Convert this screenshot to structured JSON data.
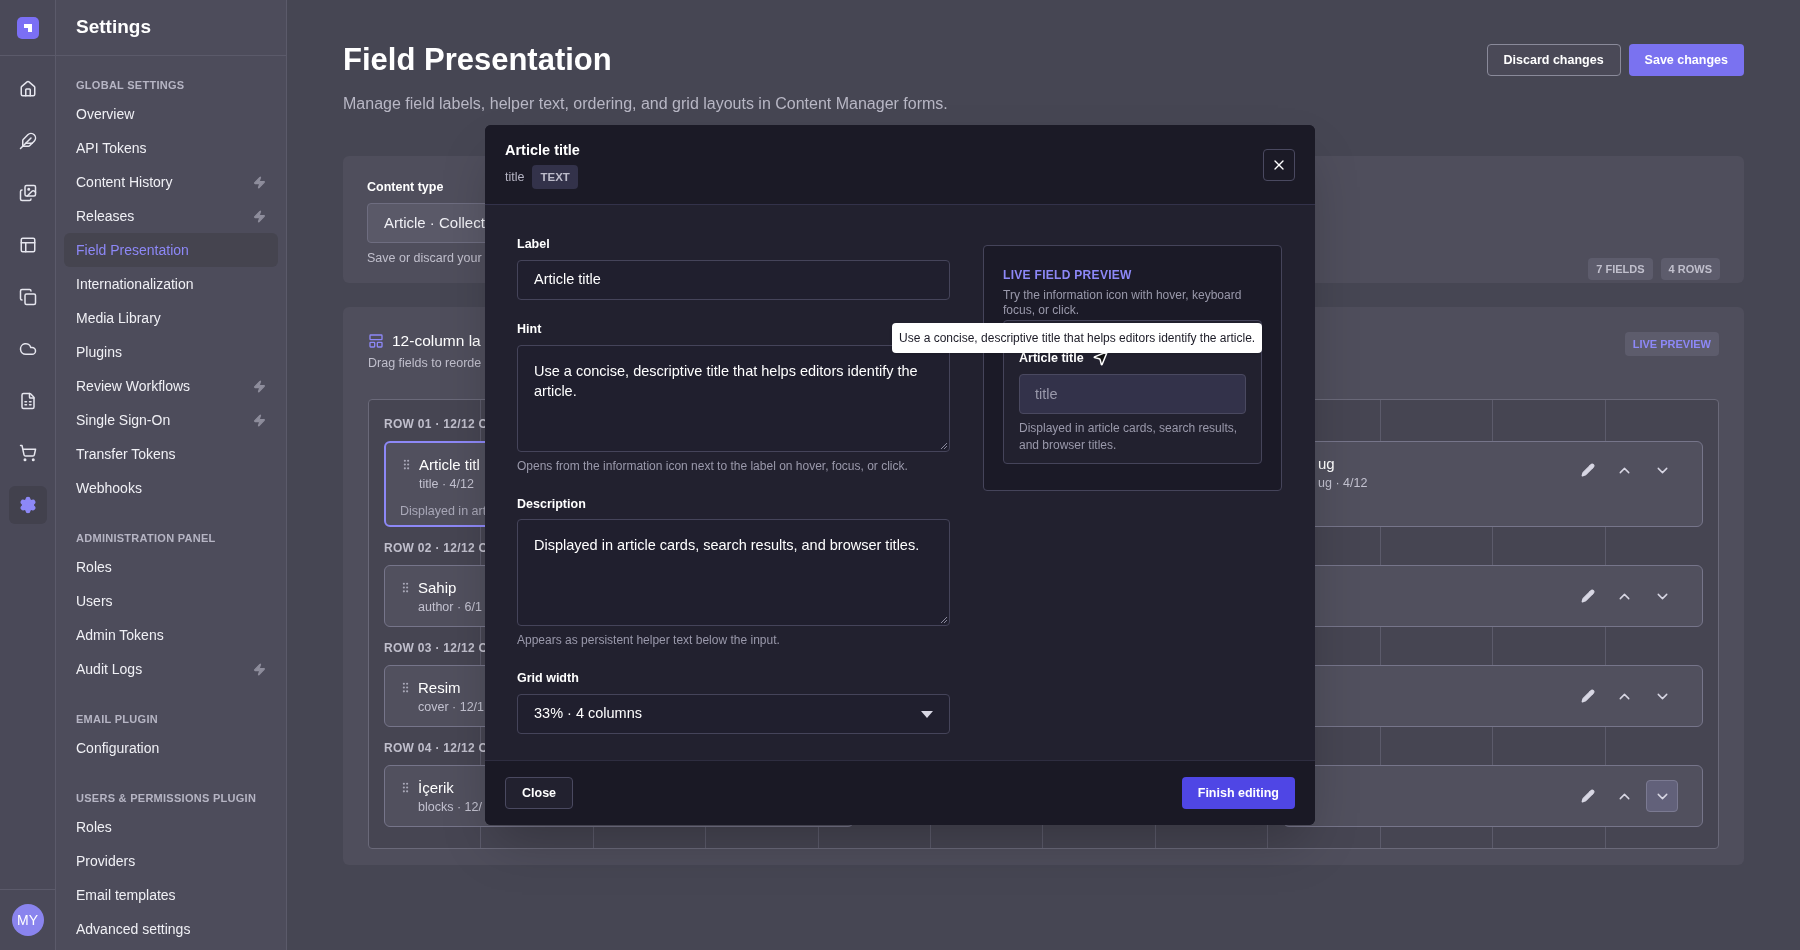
{
  "rail": {
    "items": [
      {
        "kind": "home",
        "selected": false
      },
      {
        "kind": "feather",
        "selected": false
      },
      {
        "kind": "images",
        "selected": false
      },
      {
        "kind": "layout",
        "selected": false
      },
      {
        "kind": "copy",
        "selected": false
      },
      {
        "kind": "cloud",
        "selected": false
      },
      {
        "kind": "spreadsheet",
        "selected": false
      },
      {
        "kind": "cart",
        "selected": false
      },
      {
        "kind": "settings",
        "selected": true
      }
    ],
    "avatar": "MY"
  },
  "sidebar": {
    "title": "Settings",
    "sections": [
      {
        "heading": "GLOBAL SETTINGS",
        "items": [
          {
            "label": "Overview",
            "selected": false,
            "bolt": false
          },
          {
            "label": "API Tokens",
            "selected": false,
            "bolt": false
          },
          {
            "label": "Content History",
            "selected": false,
            "bolt": true
          },
          {
            "label": "Releases",
            "selected": false,
            "bolt": true
          },
          {
            "label": "Field Presentation",
            "selected": true,
            "bolt": false
          },
          {
            "label": "Internationalization",
            "selected": false,
            "bolt": false
          },
          {
            "label": "Media Library",
            "selected": false,
            "bolt": false
          },
          {
            "label": "Plugins",
            "selected": false,
            "bolt": false
          },
          {
            "label": "Review Workflows",
            "selected": false,
            "bolt": true
          },
          {
            "label": "Single Sign-On",
            "selected": false,
            "bolt": true
          },
          {
            "label": "Transfer Tokens",
            "selected": false,
            "bolt": false
          },
          {
            "label": "Webhooks",
            "selected": false,
            "bolt": false
          }
        ]
      },
      {
        "heading": "ADMINISTRATION PANEL",
        "items": [
          {
            "label": "Roles",
            "selected": false,
            "bolt": false
          },
          {
            "label": "Users",
            "selected": false,
            "bolt": false
          },
          {
            "label": "Admin Tokens",
            "selected": false,
            "bolt": false
          },
          {
            "label": "Audit Logs",
            "selected": false,
            "bolt": true
          }
        ]
      },
      {
        "heading": "EMAIL PLUGIN",
        "items": [
          {
            "label": "Configuration",
            "selected": false,
            "bolt": false
          }
        ]
      },
      {
        "heading": "USERS & PERMISSIONS PLUGIN",
        "items": [
          {
            "label": "Roles",
            "selected": false,
            "bolt": false
          },
          {
            "label": "Providers",
            "selected": false,
            "bolt": false
          },
          {
            "label": "Email templates",
            "selected": false,
            "bolt": false
          },
          {
            "label": "Advanced settings",
            "selected": false,
            "bolt": false
          }
        ]
      }
    ]
  },
  "page": {
    "title": "Field Presentation",
    "subtitle": "Manage field labels, helper text, ordering, and grid layouts in Content Manager forms.",
    "actions": [
      {
        "label": "Discard changes",
        "kind": "secondary"
      },
      {
        "label": "Save changes",
        "kind": "primary"
      }
    ]
  },
  "content_type": {
    "label": "Content type",
    "value": "Article · Collect",
    "helper": "Save or discard your",
    "badges": [
      "7 FIELDS",
      "4 ROWS"
    ]
  },
  "layout": {
    "title": "12-column la",
    "subtitle": "Drag fields to reorde",
    "badge": "LIVE PREVIEW",
    "rows": [
      {
        "label": "ROW 01 · 12/12 C",
        "left_card": {
          "name": "Article titl",
          "meta": "title · 4/12",
          "description": "Displayed in art",
          "selected": true
        },
        "right_card": {
          "name": "ug",
          "meta": "ug · 4/12",
          "down_focused": false
        }
      },
      {
        "label": "ROW 02 · 12/12 C",
        "left_card": {
          "name": "Sahip",
          "meta": "author · 6/1",
          "selected": false
        },
        "right_card": {
          "down_focused": false
        }
      },
      {
        "label": "ROW 03 · 12/12 C",
        "left_card": {
          "name": "Resim",
          "meta": "cover · 12/1",
          "selected": false
        },
        "right_card": {
          "down_focused": false
        }
      },
      {
        "label": "ROW 04 · 12/12 C",
        "left_card": {
          "name": "İçerik",
          "meta": "blocks · 12/",
          "selected": false
        },
        "right_card": {
          "down_focused": true
        }
      }
    ]
  },
  "dialog": {
    "title": "Article title",
    "api_name": "title",
    "type_badge": "TEXT",
    "fields": [
      {
        "kind": "input",
        "label": "Label",
        "value": "Article title"
      },
      {
        "kind": "textarea",
        "label": "Hint",
        "value": "Use a concise, descriptive title that helps editors identify the article.",
        "helper": "Opens from the information icon next to the label on hover, focus, or click."
      },
      {
        "kind": "textarea",
        "label": "Description",
        "value": "Displayed in article cards, search results, and browser titles.",
        "helper": "Appears as persistent helper text below the input."
      },
      {
        "kind": "select",
        "label": "Grid width",
        "value": "33% · 4 columns"
      }
    ],
    "preview": {
      "heading": "LIVE FIELD PREVIEW",
      "intro": "Try the information icon with hover, keyboard focus, or click.",
      "field_label": "Article title",
      "placeholder": "title",
      "helper": "Displayed in article cards, search results, and browser titles.",
      "tooltip": "Use a concise, descriptive title that helps editors identify the article."
    },
    "buttons": [
      {
        "label": "Close",
        "kind": "secondary"
      },
      {
        "label": "Finish editing",
        "kind": "primary"
      }
    ]
  }
}
